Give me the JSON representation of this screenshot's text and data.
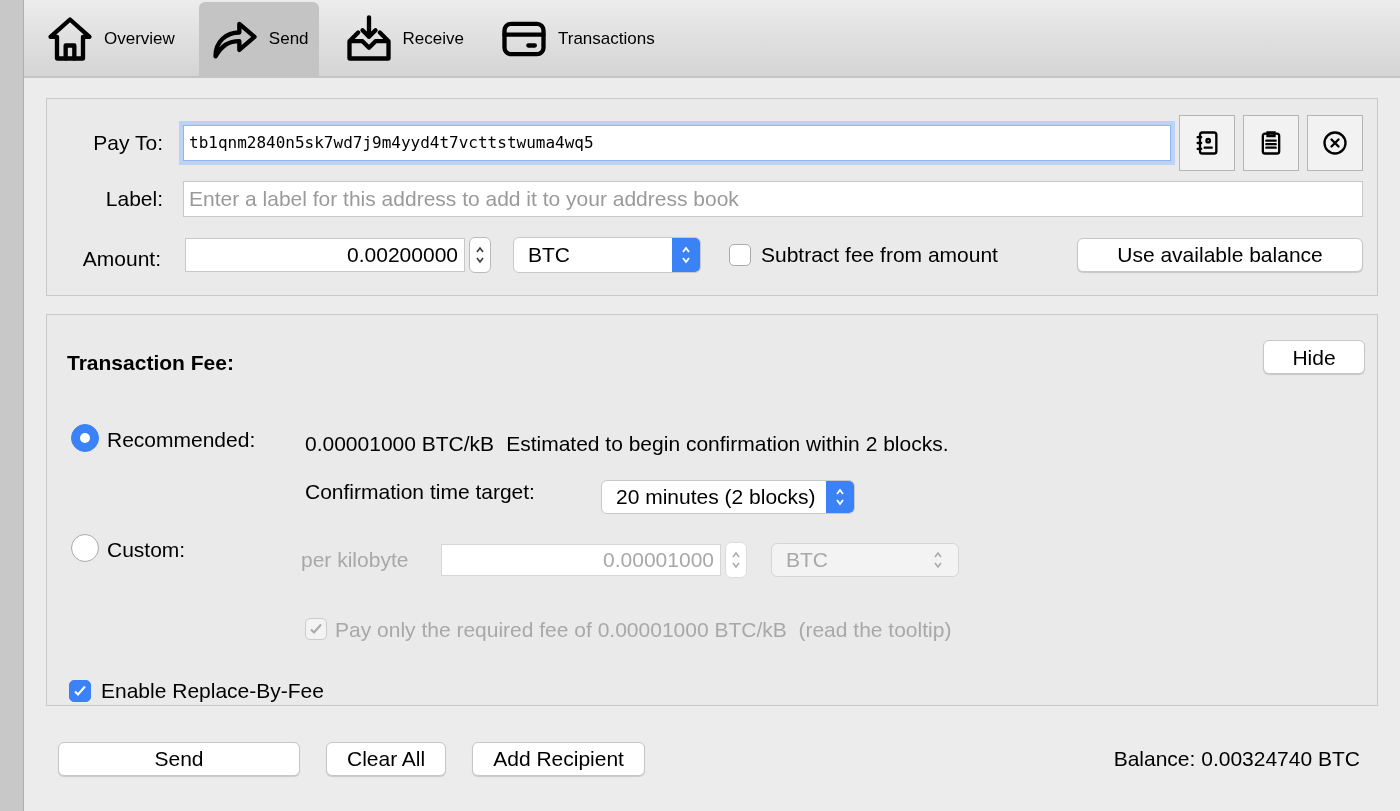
{
  "tabs": [
    {
      "label": "Overview",
      "kind": "home",
      "selected": false
    },
    {
      "label": "Send",
      "kind": "send",
      "selected": true
    },
    {
      "label": "Receive",
      "kind": "receive",
      "selected": false
    },
    {
      "label": "Transactions",
      "kind": "transactions",
      "selected": false
    }
  ],
  "recipient": {
    "pay_to": {
      "label": "Pay To:",
      "value": "tb1qnm2840n5sk7wd7j9m4yyd4t7vcttstwuma4wq5",
      "focused": true
    },
    "address_buttons": [
      {
        "kind": "address-book"
      },
      {
        "kind": "paste"
      },
      {
        "kind": "clear"
      }
    ],
    "label_field": {
      "label": "Label:",
      "placeholder": "Enter a label for this address to add it to your address book"
    },
    "amount": {
      "label": "Amount:",
      "value": "0.00200000",
      "unit": "BTC"
    },
    "subtract_fee": {
      "label": "Subtract fee from amount",
      "checked": false
    },
    "use_balance_button": "Use available balance"
  },
  "fee": {
    "title": "Transaction Fee:",
    "hide_button": "Hide",
    "recommended": {
      "label": "Recommended:",
      "selected": true,
      "rate": "0.00001000 BTC/kB",
      "estimate": "Estimated to begin confirmation within 2 blocks.",
      "target_label": "Confirmation time target:",
      "target_value": "20 minutes (2 blocks)"
    },
    "custom": {
      "label": "Custom:",
      "selected": false,
      "per_label": "per kilobyte",
      "value": "0.00001000",
      "unit": "BTC",
      "disabled": true
    },
    "pay_only": {
      "label": "Pay only the required fee of 0.00001000 BTC/kB  (read the tooltip)",
      "checked": true,
      "disabled": true
    },
    "rbf": {
      "label": "Enable Replace-By-Fee",
      "checked": true
    }
  },
  "footer": {
    "buttons": [
      "Send",
      "Clear All",
      "Add Recipient"
    ],
    "balance": "Balance: 0.00324740 BTC"
  }
}
